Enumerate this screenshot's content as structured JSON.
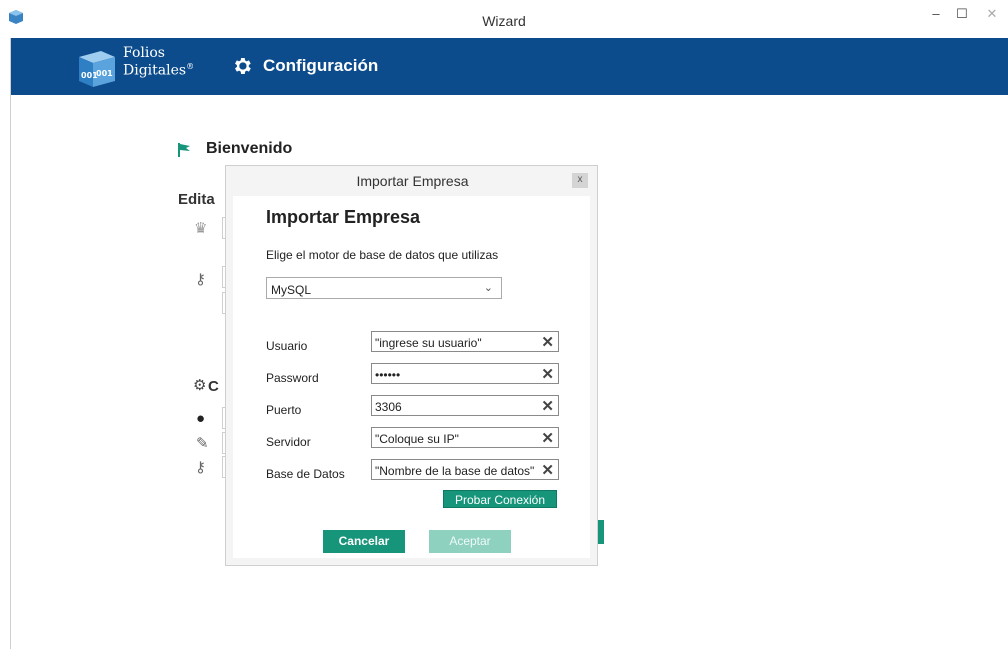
{
  "window": {
    "title": "Wizard",
    "min": "–",
    "max": "☐",
    "close": "✕"
  },
  "header": {
    "logo_line1": "Folios",
    "logo_line2": "Digitales",
    "logo_reg": "®",
    "title": "Configuración"
  },
  "background": {
    "welcome": "Bienvenido",
    "edit_partial": "Edita",
    "section_partial": "C"
  },
  "dialog": {
    "title": "Importar Empresa",
    "close": "x",
    "heading": "Importar Empresa",
    "subtitle": "Elige el motor de base de datos que utilizas",
    "engine": "MySQL",
    "fields": [
      {
        "label": "Usuario",
        "value": "\"ingrese su usuario\""
      },
      {
        "label": "Password",
        "value": "••••••"
      },
      {
        "label": "Puerto",
        "value": "3306"
      },
      {
        "label": "Servidor",
        "value": "\"Coloque su IP\""
      },
      {
        "label": "Base de Datos",
        "value": "\"Nombre de la base de datos\""
      }
    ],
    "clear_glyph": "✕",
    "test_button": "Probar Conexión",
    "cancel_button": "Cancelar",
    "accept_button": "Aceptar"
  },
  "colors": {
    "header_bg": "#0d4c8c",
    "accent": "#16957a",
    "accent_disabled": "#8fd1bf"
  }
}
